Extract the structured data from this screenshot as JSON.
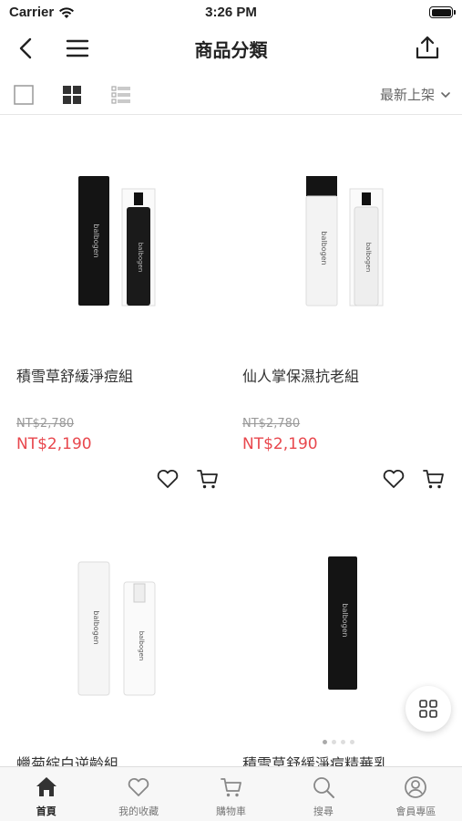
{
  "status_bar": {
    "carrier": "Carrier",
    "time": "3:26 PM"
  },
  "nav": {
    "title": "商品分類",
    "icons": [
      "back-icon",
      "menu-icon",
      "share-icon"
    ]
  },
  "toolbar": {
    "view_modes": [
      "single-view-icon",
      "grid-view-icon",
      "list-view-icon"
    ],
    "active_view": "grid-view-icon",
    "sort_label": "最新上架"
  },
  "products": [
    {
      "name": "積雪草舒緩淨痘組",
      "original_price": "NT$2,780",
      "price": "NT$2,190",
      "bottle_color": "#1a1a1a"
    },
    {
      "name": "仙人掌保濕抗老組",
      "original_price": "NT$2,780",
      "price": "NT$2,190",
      "bottle_color": "#f2f2f2"
    },
    {
      "name": "蠟菊綻白逆齡組",
      "bottle_color": "#f5f5f5"
    },
    {
      "name": "積雪草舒緩淨痘精華乳",
      "bottle_color": "#1a1a1a"
    }
  ],
  "colors": {
    "price": "#e8474d",
    "original_price": "#999999"
  },
  "tabs": [
    {
      "label": "首頁",
      "icon": "home-icon",
      "active": true
    },
    {
      "label": "我的收藏",
      "icon": "heart-icon",
      "active": false
    },
    {
      "label": "購物車",
      "icon": "cart-icon",
      "active": false
    },
    {
      "label": "搜尋",
      "icon": "search-icon",
      "active": false
    },
    {
      "label": "會員專區",
      "icon": "user-icon",
      "active": false
    }
  ]
}
